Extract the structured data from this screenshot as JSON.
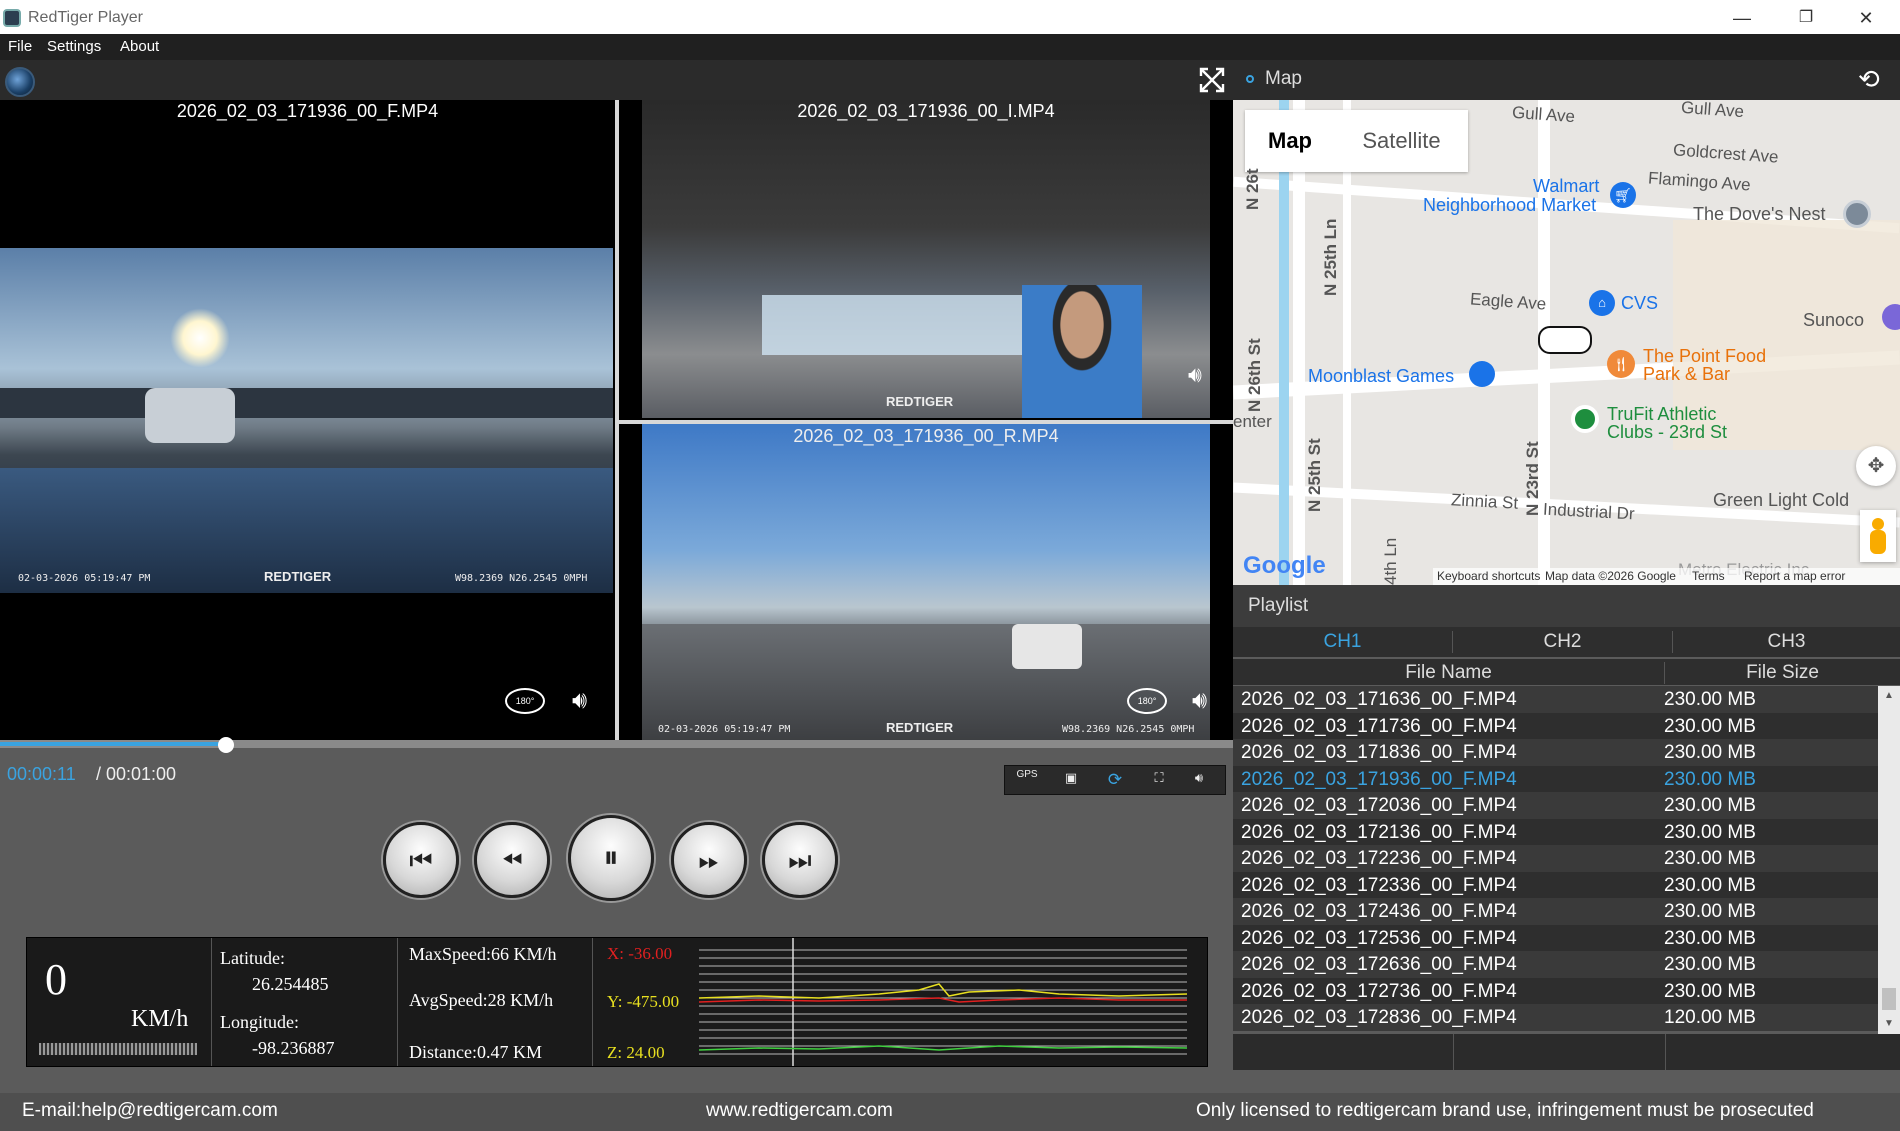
{
  "window": {
    "title": "RedTiger Player",
    "minimize": "—",
    "restore": "❐",
    "close": "✕"
  },
  "menu": {
    "file": "File",
    "settings": "Settings",
    "about": "About"
  },
  "videos": {
    "front_label": "2026_02_03_171936_00_F.MP4",
    "interior_label": "2026_02_03_171936_00_I.MP4",
    "rear_label": "2026_02_03_171936_00_R.MP4",
    "brand": "REDTIGER",
    "front_stamp": "02-03-2026 05:19:47 PM",
    "front_gps": "W98.2369 N26.2545 0MPH",
    "rear_stamp": "02-03-2026 05:19:47 PM",
    "rear_gps": "W98.2369 N26.2545 0MPH",
    "rotate_label": "180°"
  },
  "playback": {
    "current": "00:00:11",
    "total": "/ 00:01:00",
    "progress": 0.183
  },
  "tools": {
    "gps": "GPS"
  },
  "info": {
    "speed": "0",
    "speed_unit": "KM/h",
    "lat_label": "Latitude:",
    "lat": "26.254485",
    "lon_label": "Longitude:",
    "lon": "-98.236887",
    "max_speed": "MaxSpeed:66 KM/h",
    "avg_speed": "AvgSpeed:28 KM/h",
    "distance": "Distance:0.47 KM",
    "x": "X: -36.00",
    "y": "Y: -475.00",
    "z": "Z: 24.00"
  },
  "map": {
    "header": "Map",
    "tab_map": "Map",
    "tab_satellite": "Satellite",
    "labels": {
      "gull": "Gull Ave",
      "gull2": "Gull Ave",
      "goldcrest": "Goldcrest Ave",
      "flamingo": "Flamingo Ave",
      "walmart": "Walmart",
      "neighborhood": "Neighborhood Market",
      "doves": "The Dove's Nest",
      "eagle": "Eagle Ave",
      "cvs": "CVS",
      "sunoco": "Sunoco",
      "point": "The Point Food",
      "park": "Park & Bar",
      "moonblast": "Moonblast Games",
      "trufit": "TruFit Athletic",
      "clubs": "Clubs - 23rd St",
      "zinnia": "Zinnia St",
      "industrial": "Industrial Dr",
      "green": "Green Light Cold",
      "n26": "N 26t",
      "n25": "N 25th Ln",
      "n26st": "N 26th St",
      "n25st": "N 25th St",
      "n23": "N 23rd St",
      "n24": "4th Ln",
      "center": "enter",
      "metro": "Metro Electric Inc"
    },
    "google": "Google",
    "keyboard": "Keyboard shortcuts",
    "mapdata": "Map data ©2026 Google",
    "terms": "Terms",
    "report": "Report a map error"
  },
  "playlist": {
    "header": "Playlist",
    "tabs": [
      "CH1",
      "CH2",
      "CH3"
    ],
    "col_name": "File Name",
    "col_size": "File Size",
    "rows": [
      {
        "name": "2026_02_03_171636_00_F.MP4",
        "size": "230.00 MB"
      },
      {
        "name": "2026_02_03_171736_00_F.MP4",
        "size": "230.00 MB"
      },
      {
        "name": "2026_02_03_171836_00_F.MP4",
        "size": "230.00 MB"
      },
      {
        "name": "2026_02_03_171936_00_F.MP4",
        "size": "230.00 MB"
      },
      {
        "name": "2026_02_03_172036_00_F.MP4",
        "size": "230.00 MB"
      },
      {
        "name": "2026_02_03_172136_00_F.MP4",
        "size": "230.00 MB"
      },
      {
        "name": "2026_02_03_172236_00_F.MP4",
        "size": "230.00 MB"
      },
      {
        "name": "2026_02_03_172336_00_F.MP4",
        "size": "230.00 MB"
      },
      {
        "name": "2026_02_03_172436_00_F.MP4",
        "size": "230.00 MB"
      },
      {
        "name": "2026_02_03_172536_00_F.MP4",
        "size": "230.00 MB"
      },
      {
        "name": "2026_02_03_172636_00_F.MP4",
        "size": "230.00 MB"
      },
      {
        "name": "2026_02_03_172736_00_F.MP4",
        "size": "230.00 MB"
      },
      {
        "name": "2026_02_03_172836_00_F.MP4",
        "size": "120.00 MB"
      }
    ],
    "selected_index": 3
  },
  "footer": {
    "email": "E-mail:help@redtigercam.com",
    "site": "www.redtigercam.com",
    "license": "Only licensed to redtigercam brand use, infringement must be prosecuted"
  },
  "colors": {
    "accent": "#3aa3e0",
    "x_color": "#e02020",
    "y_color": "#e8e020",
    "z_color": "#40d040"
  }
}
